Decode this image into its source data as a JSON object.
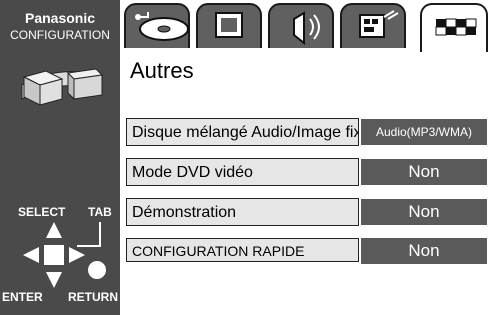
{
  "sidebar": {
    "brand": "Panasonic",
    "subtitle": "CONFIGURATION",
    "logo_icon": "configuration-logo-icon",
    "nav": {
      "select": "SELECT",
      "tab": "TAB",
      "enter": "ENTER",
      "return": "RETURN"
    }
  },
  "tabs": [
    {
      "icon": "disc-icon"
    },
    {
      "icon": "screen-icon"
    },
    {
      "icon": "speaker-icon"
    },
    {
      "icon": "display-icon"
    },
    {
      "icon": "others-icon",
      "active": true
    }
  ],
  "page": {
    "title": "Autres"
  },
  "settings": [
    {
      "label": "Disque mélangé Audio/Image fixe",
      "value": "Audio(MP3/WMA)"
    },
    {
      "label": "Mode DVD vidéo",
      "value": "Non"
    },
    {
      "label": "Démonstration",
      "value": "Non"
    },
    {
      "label": "CONFIGURATION RAPIDE",
      "value": "Non"
    }
  ],
  "colors": {
    "sidebar_bg": "#4a4a4a",
    "value_bg": "#5a5a5a",
    "label_bg": "#e6e6e6",
    "tab_bg": "#606060"
  }
}
